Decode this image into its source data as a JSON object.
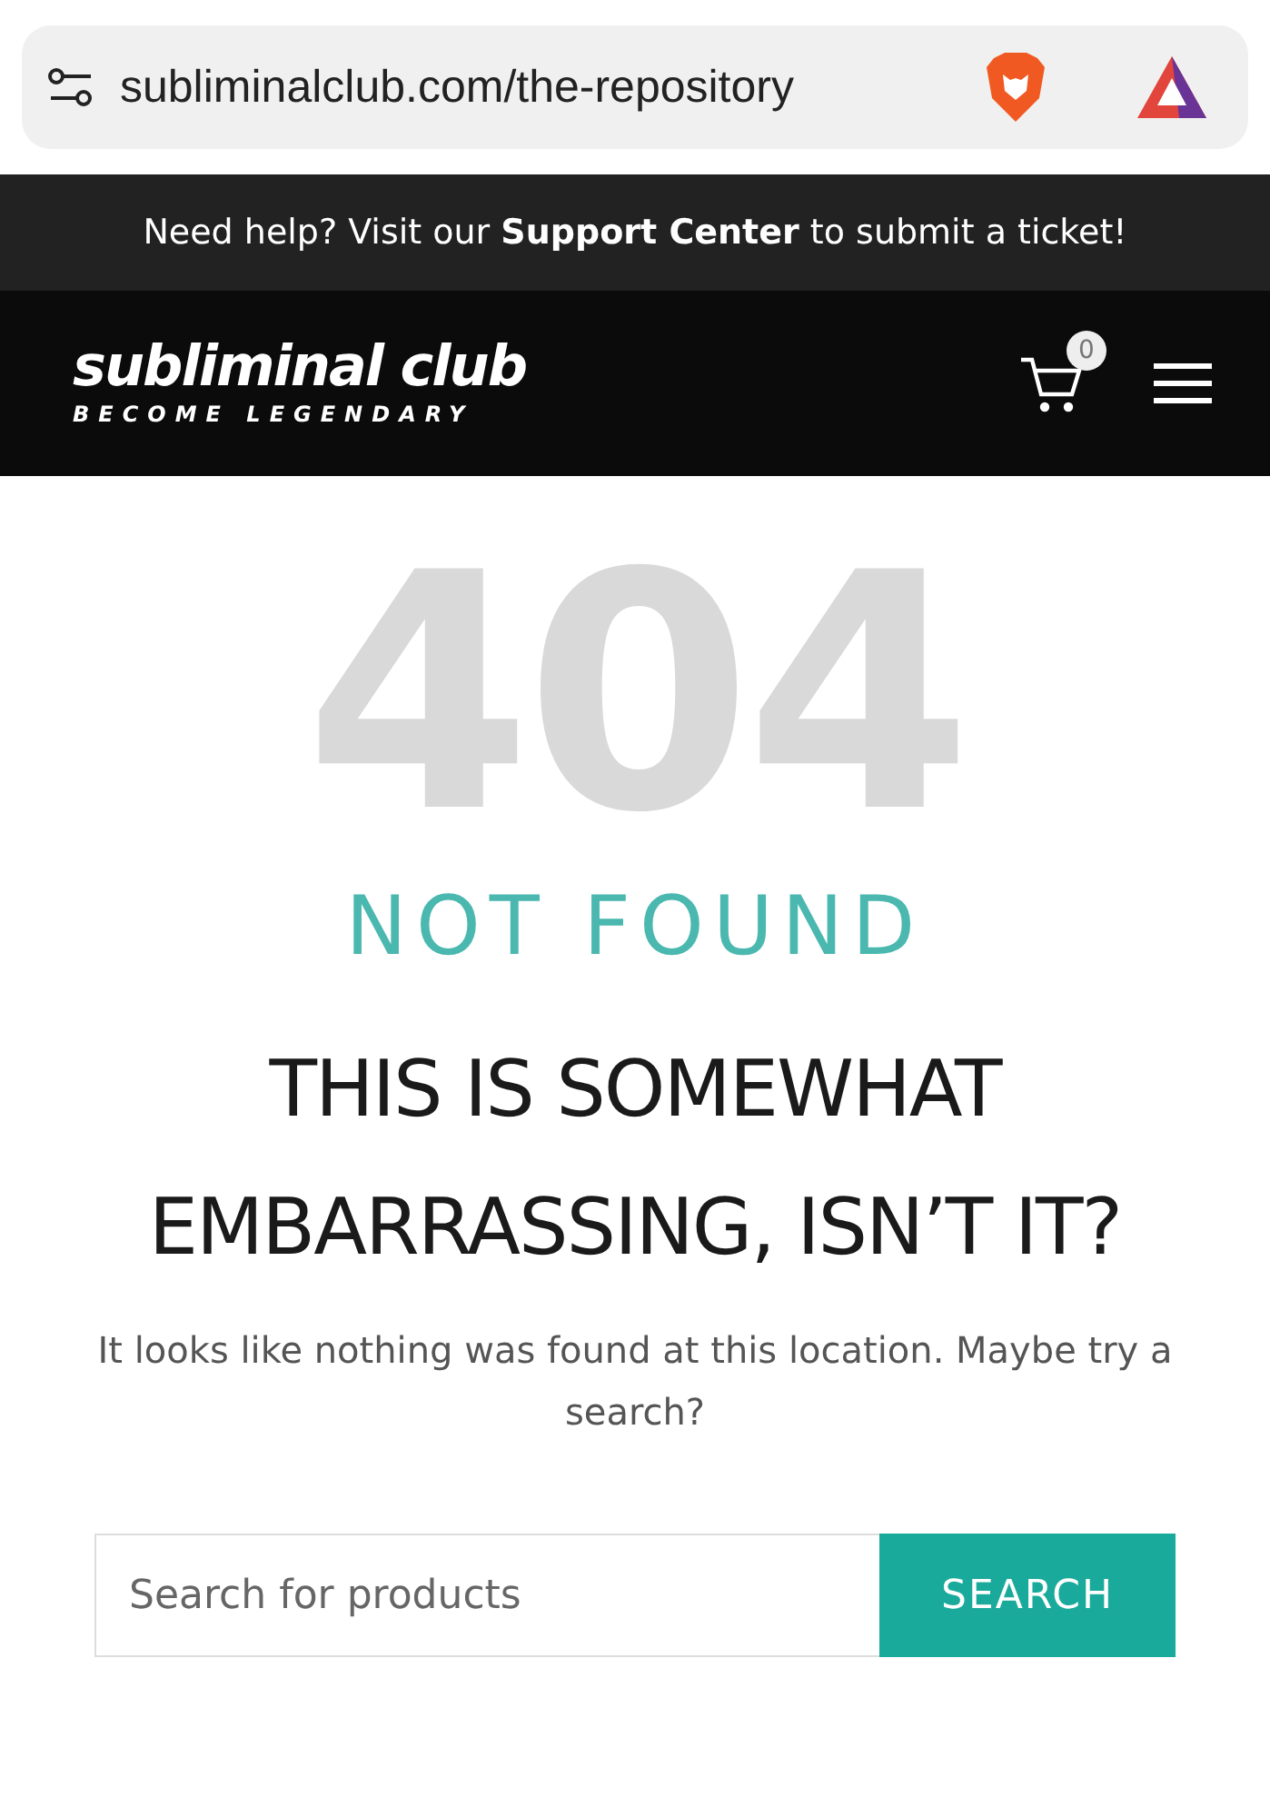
{
  "address_bar": {
    "url": "subliminalclub.com/the-repository"
  },
  "help_banner": {
    "text": "Need help? Visit our **Support Center** to submit a ticket!"
  },
  "header": {
    "logo_title": "subliminal club",
    "logo_tagline": "BECOME LEGENDARY",
    "cart_count": "0"
  },
  "error": {
    "code": "404",
    "label": "NOT FOUND",
    "heading": "THIS IS SOMEWHAT EMBARRASSING, ISN’T IT?",
    "message": "It looks like nothing was found at this location. Maybe try a search?"
  },
  "search": {
    "placeholder": "Search for products",
    "button": "SEARCH"
  }
}
